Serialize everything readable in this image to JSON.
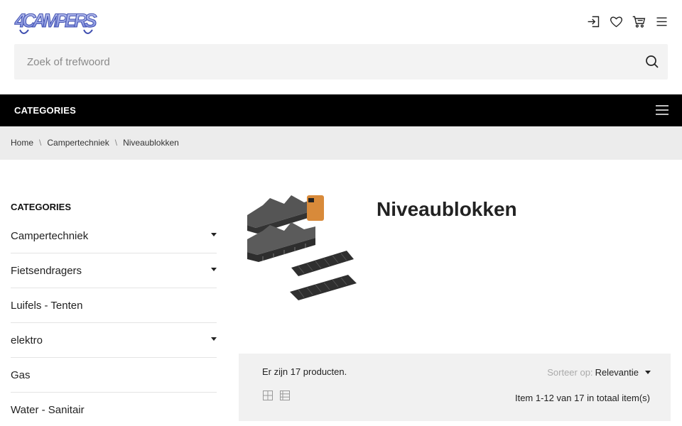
{
  "header": {
    "logo_text": "4CAMPERS",
    "icons": [
      "login-icon",
      "heart-icon",
      "cart-icon",
      "hamburger-menu-icon"
    ]
  },
  "search": {
    "placeholder": "Zoek of trefwoord",
    "value": ""
  },
  "category_bar": {
    "label": "CATEGORIES"
  },
  "breadcrumb": [
    {
      "label": "Home"
    },
    {
      "label": "Campertechniek"
    },
    {
      "label": "Niveaublokken"
    }
  ],
  "sidebar": {
    "title": "CATEGORIES",
    "items": [
      {
        "label": "Campertechniek",
        "expandable": true
      },
      {
        "label": "Fietsendragers",
        "expandable": true
      },
      {
        "label": "Luifels - Tenten",
        "expandable": false
      },
      {
        "label": "elektro",
        "expandable": true
      },
      {
        "label": "Gas",
        "expandable": false
      },
      {
        "label": "Water - Sanitair",
        "expandable": false
      }
    ]
  },
  "category": {
    "title": "Niveaublokken"
  },
  "toolbar": {
    "count_text": "Er zijn 17 producten.",
    "sort_label": "Sorteer op:",
    "sort_value": "Relevantie",
    "pagination_text": "Item 1-12 van 17 in totaal item(s)",
    "views": [
      "grid-view-icon",
      "list-view-icon"
    ]
  },
  "colors": {
    "category_bar_bg": "#000000",
    "breadcrumb_bg": "#ececec",
    "toolbar_bg": "#f1f1f1",
    "logo_blue": "#5b6fd1"
  }
}
